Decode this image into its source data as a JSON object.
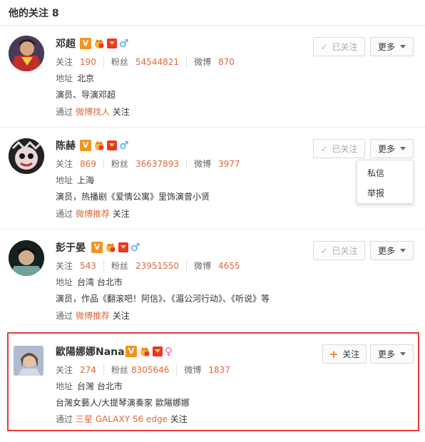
{
  "header": {
    "title": "他的关注 8"
  },
  "labels": {
    "follow": "关注",
    "fans": "粉丝",
    "weibo": "微博",
    "address": "地址",
    "via": "通过",
    "followed_btn": "已关注",
    "follow_btn": "关注",
    "more_btn": "更多"
  },
  "users": [
    {
      "name": "邓超",
      "gender": "male",
      "follow": "190",
      "fans": "54544821",
      "weibo": "870",
      "address": "北京",
      "bio": "演员、导演邓超",
      "source": "微博找人",
      "source_suffix": "关注",
      "followed": true
    },
    {
      "name": "陈赫",
      "gender": "male",
      "follow": "869",
      "fans": "36637893",
      "weibo": "3977",
      "address": "上海",
      "bio": "演员，热播剧《爱情公寓》里饰演曾小贤",
      "source": "微博推荐",
      "source_suffix": "关注",
      "followed": true
    },
    {
      "name": "彭于晏",
      "gender": "male",
      "follow": "543",
      "fans": "23951550",
      "weibo": "4655",
      "address": "台湾 台北市",
      "bio": "演员，作品《翻滚吧！阿信》、《湄公河行动》、《听说》等",
      "source": "微博推荐",
      "source_suffix": "关注",
      "followed": true
    },
    {
      "name": "歐陽娜娜Nana",
      "gender": "female",
      "follow": "274",
      "fans": "8305646",
      "weibo": "1837",
      "address": "台灣 台北市",
      "bio": "台灣女藝人/大提琴演奏家 歐陽娜娜",
      "source": "三星 GALAXY S6 edge",
      "source_suffix": "关注",
      "followed": false
    }
  ],
  "dropdown": {
    "items": [
      "私信",
      "举报"
    ]
  },
  "icons": {
    "verified": "V",
    "male": "♂",
    "female": "♀",
    "check": "✓",
    "plus": "+"
  },
  "colors": {
    "accent_orange": "#e0683a",
    "verified_orange": "#f4931e",
    "highlight_red": "#e33a3a",
    "male_blue": "#40a1e6",
    "female_pink": "#e86aa5"
  }
}
